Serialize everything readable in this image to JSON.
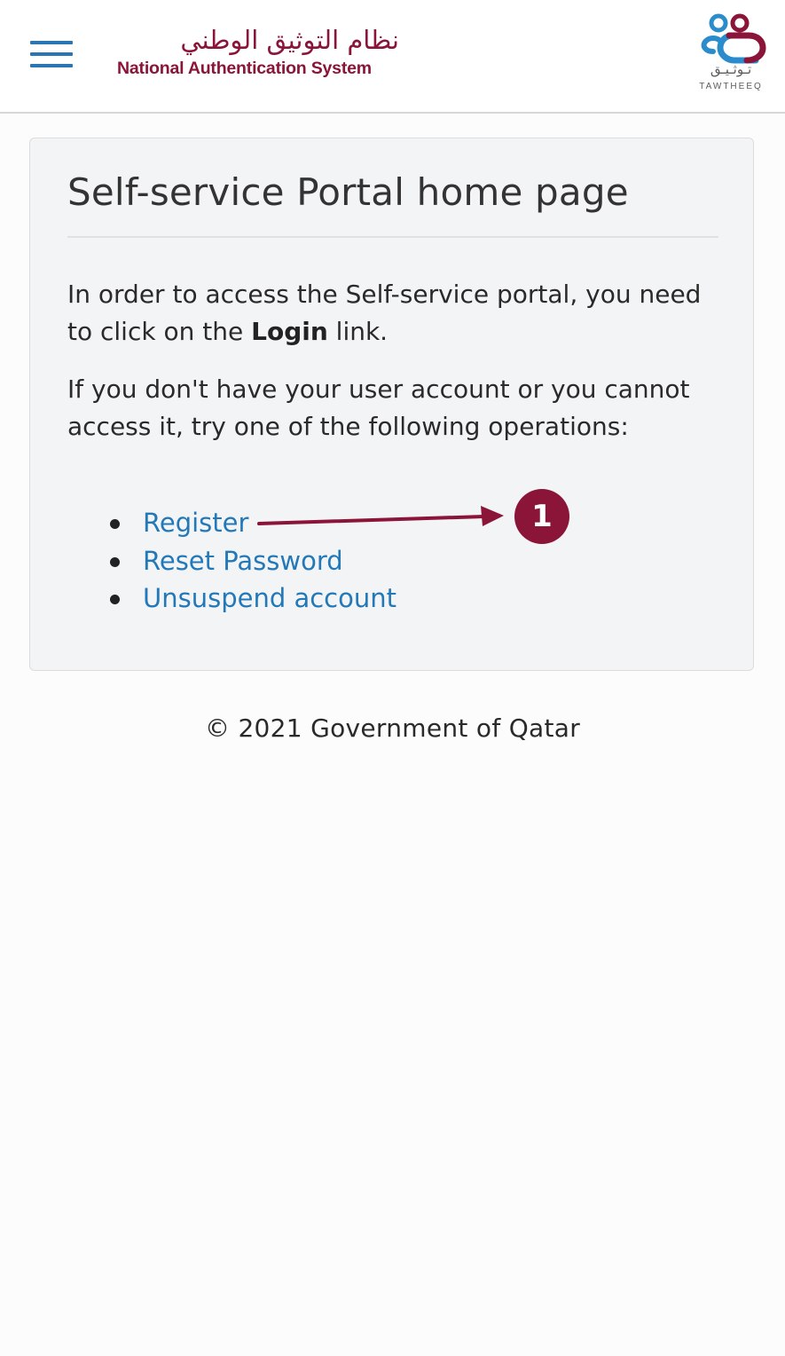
{
  "header": {
    "brand_arabic": "نظام التوثيق الوطني",
    "brand_english": "National Authentication System",
    "logo_arabic": "تـوثـيـق",
    "logo_english": "TAWTHEEQ",
    "menu_icon": "hamburger-menu-icon"
  },
  "panel": {
    "title": "Self-service Portal home page",
    "para1_before": "In order to access the Self-service portal, you need to click on the ",
    "para1_bold": "Login",
    "para1_after": " link.",
    "para2": "If you don't have your user account or you cannot access it, try one of the following operations:",
    "operations": [
      {
        "label": "Register"
      },
      {
        "label": "Reset Password"
      },
      {
        "label": "Unsuspend account"
      }
    ]
  },
  "annotation": {
    "badge_number": "1"
  },
  "footer": {
    "copyright": "© 2021 Government of Qatar"
  },
  "colors": {
    "brand_maroon": "#8a1538",
    "link_blue": "#2378b8",
    "menu_blue": "#2a76b5",
    "panel_bg": "#f3f4f6"
  }
}
